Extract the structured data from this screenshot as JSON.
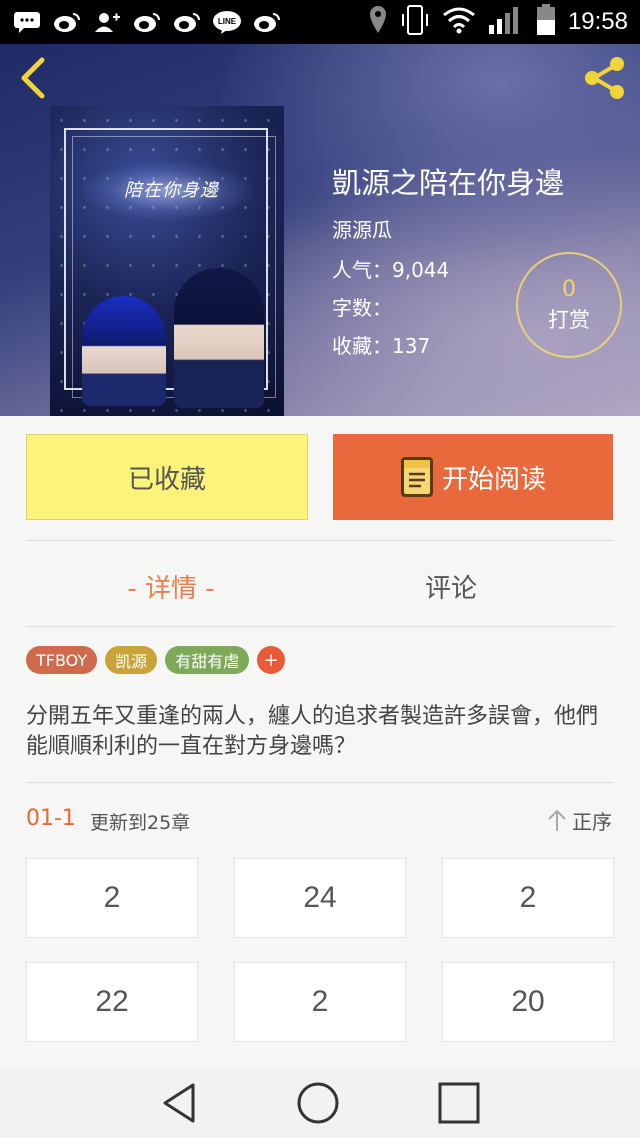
{
  "status_bar": {
    "time": "19:58",
    "left_icons": [
      "message-icon",
      "weibo-icon",
      "contact-add-icon",
      "weibo-icon",
      "weibo-icon",
      "line-icon",
      "weibo-icon"
    ],
    "right_icons": [
      "location-icon",
      "vibrate-icon",
      "wifi-icon",
      "signal-icon",
      "battery-icon"
    ]
  },
  "header": {
    "back_icon": "chevron-left-icon",
    "share_icon": "share-icon"
  },
  "book": {
    "cover_title": "陪在你身邊",
    "title": "凱源之陪在你身邊",
    "author": "源源瓜",
    "popularity": "人气：9,044",
    "word_count": "字数：",
    "favorites": "收藏：137",
    "reward_count": "0",
    "reward_label": "打赏"
  },
  "actions": {
    "collected_label": "已收藏",
    "read_label": "开始阅读"
  },
  "tabs": {
    "detail": "- 详情 -",
    "comment": "评论"
  },
  "tags": [
    {
      "label": "TFBOY",
      "color": "#cf6b4c"
    },
    {
      "label": "凯源",
      "color": "#c9a33a"
    },
    {
      "label": "有甜有虐",
      "color": "#7fa95a"
    },
    {
      "label": "+",
      "color": "#e85a3a"
    }
  ],
  "description": "分開五年又重逢的兩人，纏人的追求者製造許多誤會，他們能順順利利的一直在對方身邊嗎？",
  "chapters": {
    "range": "01-1",
    "update": "更新到25章",
    "order_label": "正序",
    "cells": [
      "2",
      "24",
      "2",
      "22",
      "2",
      "20"
    ]
  },
  "colors": {
    "accent_orange": "#e8693c",
    "collected_yellow": "#fbf37a",
    "tab_active": "#e9804b"
  }
}
